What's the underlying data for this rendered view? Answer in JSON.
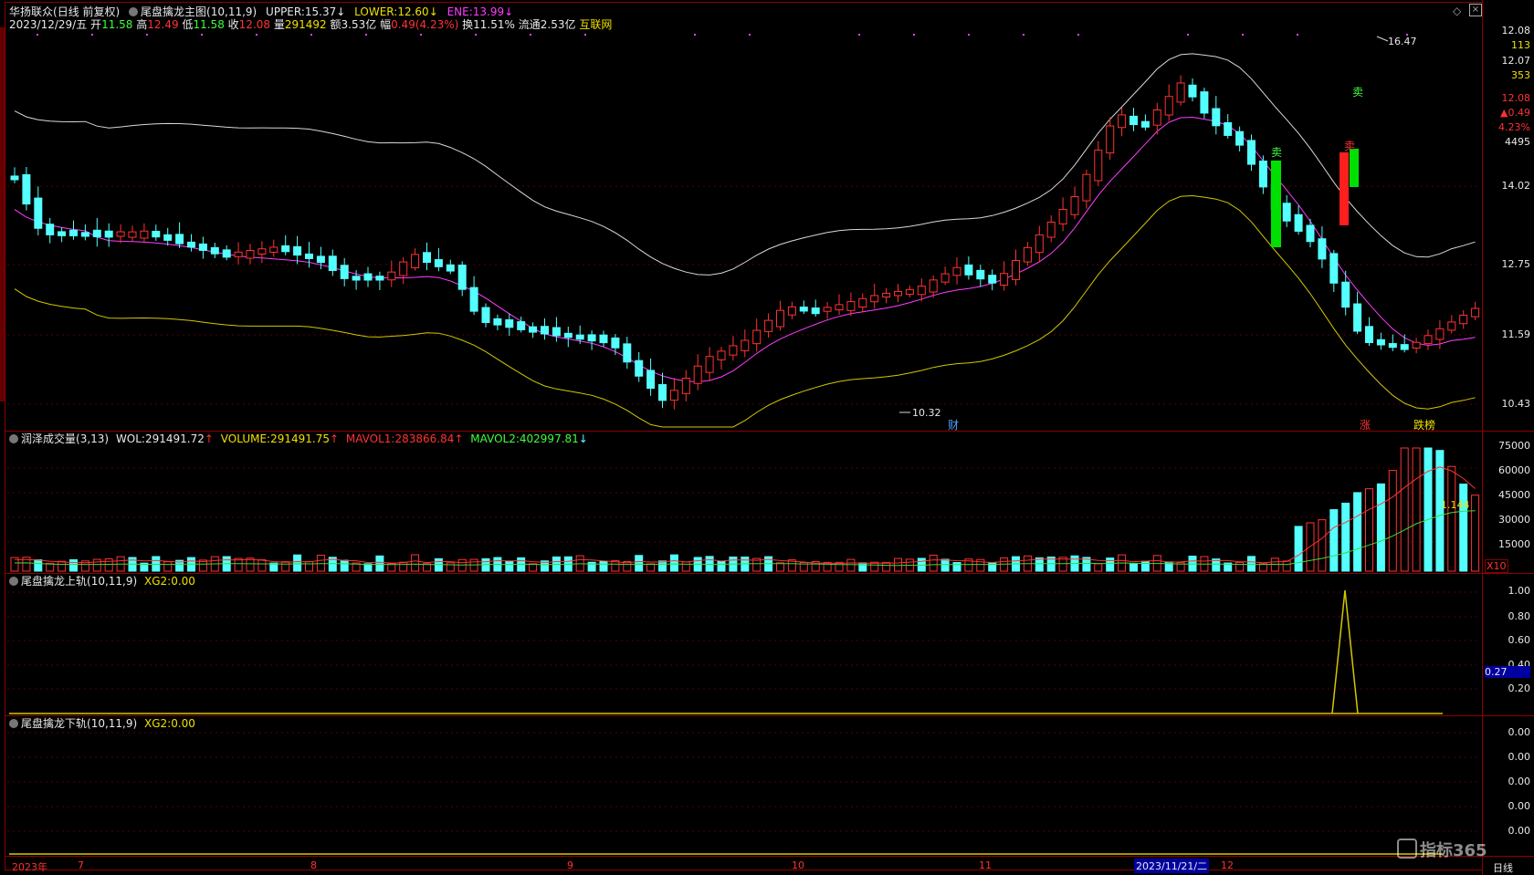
{
  "main": {
    "stock_name": "华扬联众",
    "period_mode": "(日线 前复权)",
    "indicator_name": "尾盘擒龙主图",
    "indicator_params": "(10,11,9)",
    "upper_label": "UPPER:",
    "upper_value": "15.37",
    "lower_label": "LOWER:",
    "lower_value": "12.60",
    "ene_label": "ENE:",
    "ene_value": "13.99",
    "date": "2023/12/29/五",
    "open_label": "开",
    "open_value": "11.58",
    "high_label": "高",
    "high_value": "12.49",
    "low_label": "低",
    "low_value": "11.58",
    "close_label": "收",
    "close_value": "12.08",
    "vol_label": "量",
    "vol_value": "291492",
    "amt_label": "额",
    "amt_value": "3.53亿",
    "chg_label": "幅",
    "chg_value": "0.49(4.23%)",
    "turn_label": "换",
    "turn_value": "11.51%",
    "float_label": "流通",
    "float_value": "2.53亿",
    "sector": "互联网",
    "max_label": "16.47",
    "min_label": "10.32",
    "marker_cai": "财",
    "marker_zhang": "涨",
    "marker_dieban": "跌榜",
    "sell1": "卖",
    "sell2": "卖",
    "sell3": "卖",
    "y_axis": [
      "14.02",
      "12.75",
      "11.59",
      "10.43"
    ],
    "info_panel": [
      "12.08",
      "113",
      "12.07",
      "353",
      "12.08",
      "▲0.49",
      "4.23%",
      "4495"
    ]
  },
  "volume_panel": {
    "title": "润泽成交量",
    "params": "(3,13)",
    "wol_label": "WOL:",
    "wol_value": "291491.72",
    "volume_label": "VOLUME:",
    "volume_value": "291491.75",
    "mavol1_label": "MAVOL1:",
    "mavol1_value": "283866.84",
    "mavol2_label": "MAVOL2:",
    "mavol2_value": "402997.81",
    "y_axis": [
      "75000",
      "60000",
      "45000",
      "30000",
      "15000"
    ],
    "unit": "X10",
    "ratio": "1.144"
  },
  "upper_panel": {
    "title": "尾盘擒龙上轨",
    "params": "(10,11,9)",
    "xg2_label": "XG2:",
    "xg2_value": "0.00",
    "y_axis": [
      "1.00",
      "0.80",
      "0.60",
      "0.40",
      "0.20"
    ],
    "marker": "0.27"
  },
  "lower_panel": {
    "title": "尾盘擒龙下轨",
    "params": "(10,11,9)",
    "xg2_label": "XG2:",
    "xg2_value": "0.00",
    "y_axis": [
      "0.00",
      "0.00",
      "0.00",
      "0.00",
      "0.00"
    ]
  },
  "time_axis": {
    "labels": [
      "2023年",
      "7",
      "8",
      "9",
      "10",
      "11",
      "2023/11/21/二",
      "12"
    ],
    "period": "日线",
    "watermark": "指标365"
  },
  "colors": {
    "up": "#ff3232",
    "down": "#54ffff",
    "upper_line": "#d8d8d8",
    "mid_line": "#ff3cff",
    "lower_line": "#d2c800",
    "mavol1": "#ff3232",
    "mavol2": "#3cd83c",
    "frame": "#8c0000"
  }
}
